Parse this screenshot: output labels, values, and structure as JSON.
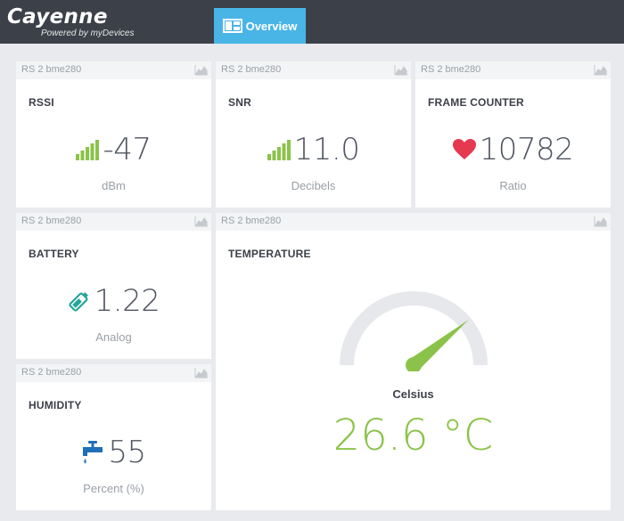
{
  "header": {
    "brand_name": "Cayenne",
    "brand_sub": "Powered by myDevices",
    "tab_label": "Overview",
    "bg_color": "#3c4049",
    "tab_color": "#49b5e6"
  },
  "widgets": [
    {
      "id": "rssi",
      "device": "RS 2 bme280",
      "title": "RSSI",
      "value": "-47",
      "unit": "dBm",
      "icon": "signal-bars-icon"
    },
    {
      "id": "snr",
      "device": "RS 2 bme280",
      "title": "SNR",
      "value": "11.0",
      "unit": "Decibels",
      "icon": "signal-bars-icon"
    },
    {
      "id": "frame",
      "device": "RS 2 bme280",
      "title": "FRAME COUNTER",
      "value": "10782",
      "unit": "Ratio",
      "icon": "heart-icon"
    },
    {
      "id": "battery",
      "device": "RS 2 bme280",
      "title": "BATTERY",
      "value": "1.22",
      "unit": "Analog",
      "icon": "battery-icon"
    },
    {
      "id": "humidity",
      "device": "RS 2 bme280",
      "title": "HUMIDITY",
      "value": "55",
      "unit": "Percent (%)",
      "icon": "water-tap-icon"
    },
    {
      "id": "temperature",
      "device": "RS 2 bme280",
      "title": "TEMPERATURE",
      "value": "26.6 °C",
      "unit": "Celsius",
      "icon": "gauge-icon",
      "gauge_level": 0.78
    }
  ],
  "colors": {
    "accent_green": "#8bc34a",
    "heart_red": "#e53950",
    "battery_teal": "#26a69a",
    "tap_blue": "#1e6fb8",
    "gauge_track": "#e6e8eb"
  }
}
